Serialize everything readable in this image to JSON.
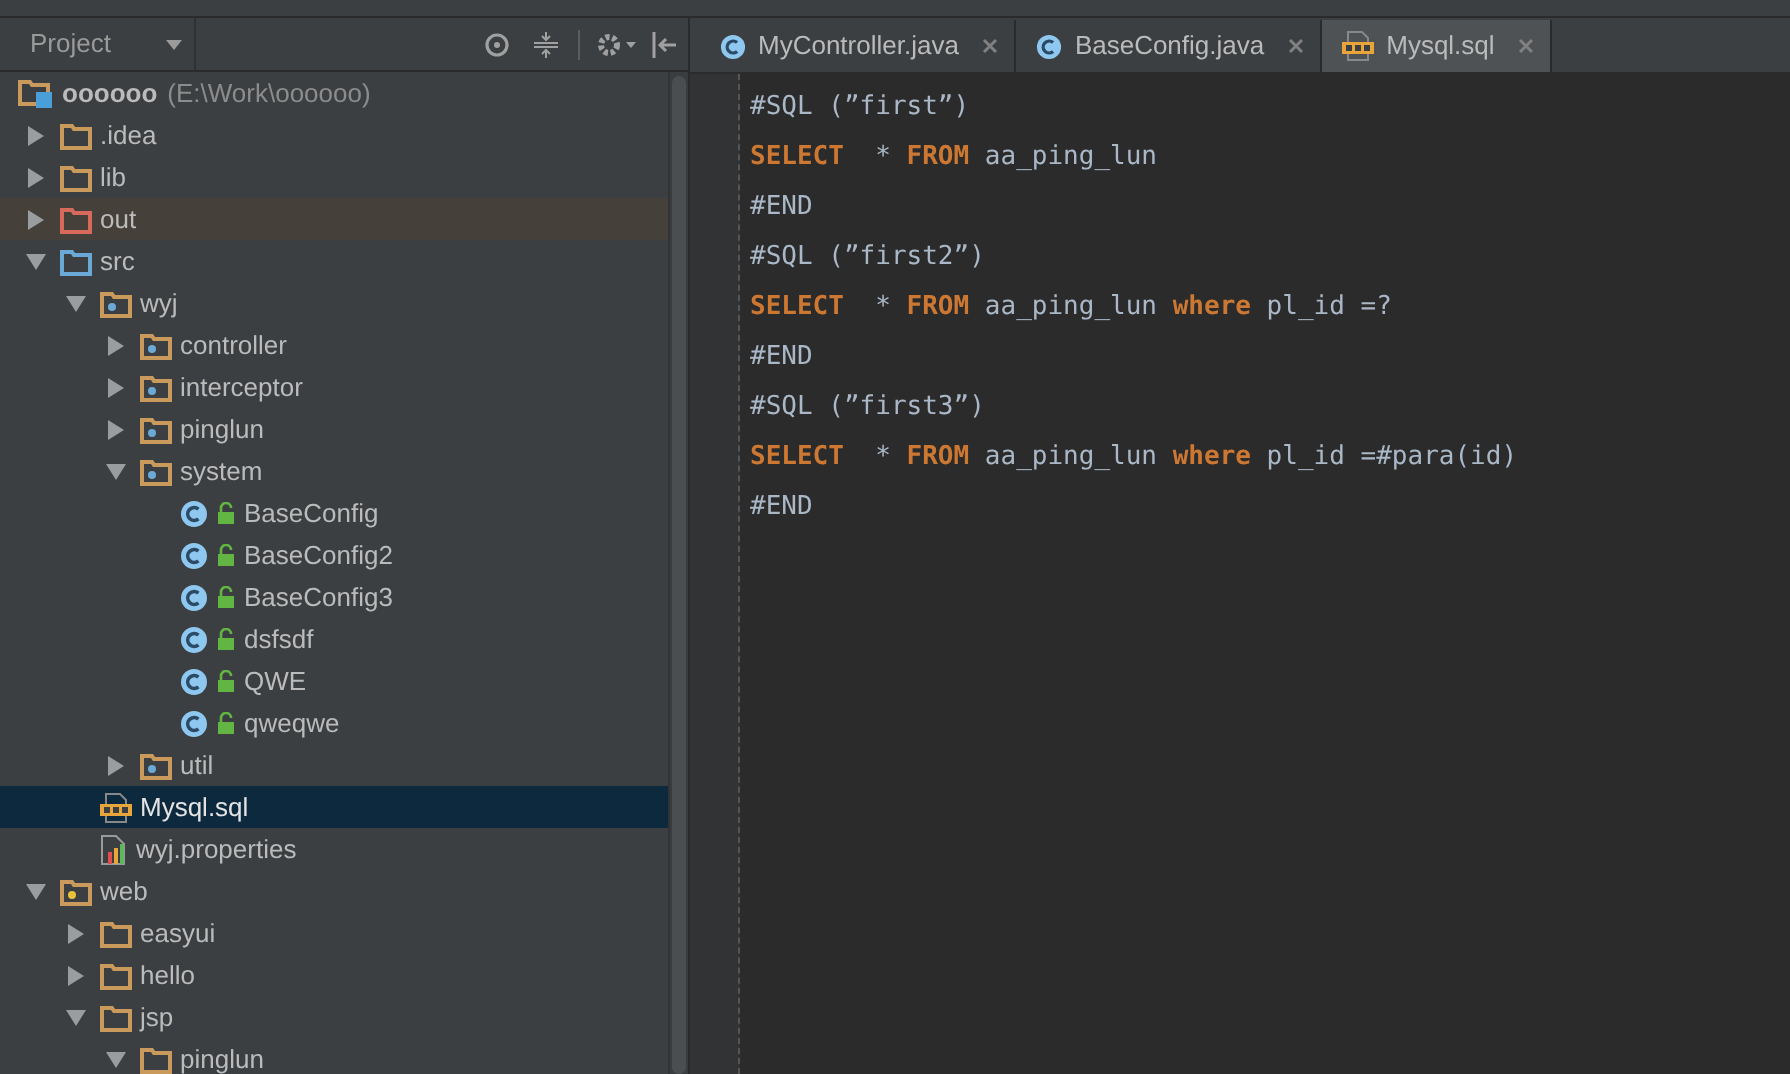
{
  "project_panel": {
    "title": "Project",
    "tree": [
      {
        "label": "oooooo",
        "path": "(E:\\Work\\oooooo)",
        "kind": "module",
        "selected": false,
        "children": [
          {
            "label": ".idea",
            "kind": "folder",
            "expanded": false,
            "selected": false
          },
          {
            "label": "lib",
            "kind": "folder",
            "expanded": false,
            "selected": false
          },
          {
            "label": "out",
            "kind": "excluded_folder",
            "expanded": false,
            "selected": false
          },
          {
            "label": "src",
            "kind": "source",
            "expanded": true,
            "selected": false,
            "children": [
              {
                "label": "wyj",
                "kind": "package",
                "expanded": true,
                "selected": false,
                "children": [
                  {
                    "label": "controller",
                    "kind": "package",
                    "expanded": false,
                    "selected": false
                  },
                  {
                    "label": "interceptor",
                    "kind": "package",
                    "expanded": false,
                    "selected": false
                  },
                  {
                    "label": "pinglun",
                    "kind": "package",
                    "expanded": false,
                    "selected": false
                  },
                  {
                    "label": "system",
                    "kind": "package",
                    "expanded": true,
                    "selected": false,
                    "children": [
                      {
                        "label": "BaseConfig",
                        "kind": "class",
                        "selected": false
                      },
                      {
                        "label": "BaseConfig2",
                        "kind": "class",
                        "selected": false
                      },
                      {
                        "label": "BaseConfig3",
                        "kind": "class",
                        "selected": false
                      },
                      {
                        "label": "dsfsdf",
                        "kind": "class",
                        "selected": false
                      },
                      {
                        "label": "QWE",
                        "kind": "class",
                        "selected": false
                      },
                      {
                        "label": "qweqwe",
                        "kind": "class",
                        "selected": false
                      }
                    ]
                  },
                  {
                    "label": "util",
                    "kind": "package",
                    "expanded": false,
                    "selected": false
                  }
                ]
              },
              {
                "label": "Mysql.sql",
                "kind": "sql",
                "selected": true
              },
              {
                "label": "wyj.properties",
                "kind": "properties",
                "selected": false
              }
            ]
          },
          {
            "label": "web",
            "kind": "web",
            "expanded": true,
            "selected": false,
            "children": [
              {
                "label": "easyui",
                "kind": "folder",
                "expanded": false,
                "selected": false
              },
              {
                "label": "hello",
                "kind": "folder",
                "expanded": false,
                "selected": false
              },
              {
                "label": "jsp",
                "kind": "folder",
                "expanded": true,
                "selected": false,
                "children": [
                  {
                    "label": "pinglun",
                    "kind": "folder",
                    "expanded": true,
                    "selected": false
                  }
                ]
              }
            ]
          }
        ]
      }
    ]
  },
  "tabs": [
    {
      "label": "MyController.java",
      "kind": "class",
      "selected": false
    },
    {
      "label": "BaseConfig.java",
      "kind": "class",
      "selected": false
    },
    {
      "label": "Mysql.sql",
      "kind": "sql",
      "selected": true
    }
  ],
  "editor": {
    "lines": [
      {
        "tokens": [
          {
            "text": "#SQL (”first”)",
            "kind": "plain"
          }
        ]
      },
      {
        "tokens": [
          {
            "text": "SELECT",
            "kind": "keyword"
          },
          {
            "text": "  * ",
            "kind": "plain"
          },
          {
            "text": "FROM",
            "kind": "keyword"
          },
          {
            "text": " aa_ping_lun",
            "kind": "plain"
          }
        ]
      },
      {
        "tokens": [
          {
            "text": "#END",
            "kind": "plain"
          }
        ]
      },
      {
        "tokens": [
          {
            "text": "#SQL (”first2”)",
            "kind": "plain"
          }
        ]
      },
      {
        "tokens": [
          {
            "text": "SELECT",
            "kind": "keyword"
          },
          {
            "text": "  * ",
            "kind": "plain"
          },
          {
            "text": "FROM",
            "kind": "keyword"
          },
          {
            "text": " aa_ping_lun ",
            "kind": "plain"
          },
          {
            "text": "where",
            "kind": "keyword"
          },
          {
            "text": " pl_id =?",
            "kind": "plain"
          }
        ]
      },
      {
        "tokens": [
          {
            "text": "#END",
            "kind": "plain"
          }
        ]
      },
      {
        "tokens": [
          {
            "text": "#SQL (”first3”)",
            "kind": "plain"
          }
        ]
      },
      {
        "tokens": [
          {
            "text": "SELECT",
            "kind": "keyword"
          },
          {
            "text": "  * ",
            "kind": "plain"
          },
          {
            "text": "FROM",
            "kind": "keyword"
          },
          {
            "text": " aa_ping_lun ",
            "kind": "plain"
          },
          {
            "text": "where",
            "kind": "keyword"
          },
          {
            "text": " pl_id =#para(id)",
            "kind": "plain"
          }
        ]
      },
      {
        "tokens": [
          {
            "text": "#END",
            "kind": "plain"
          }
        ]
      }
    ]
  }
}
